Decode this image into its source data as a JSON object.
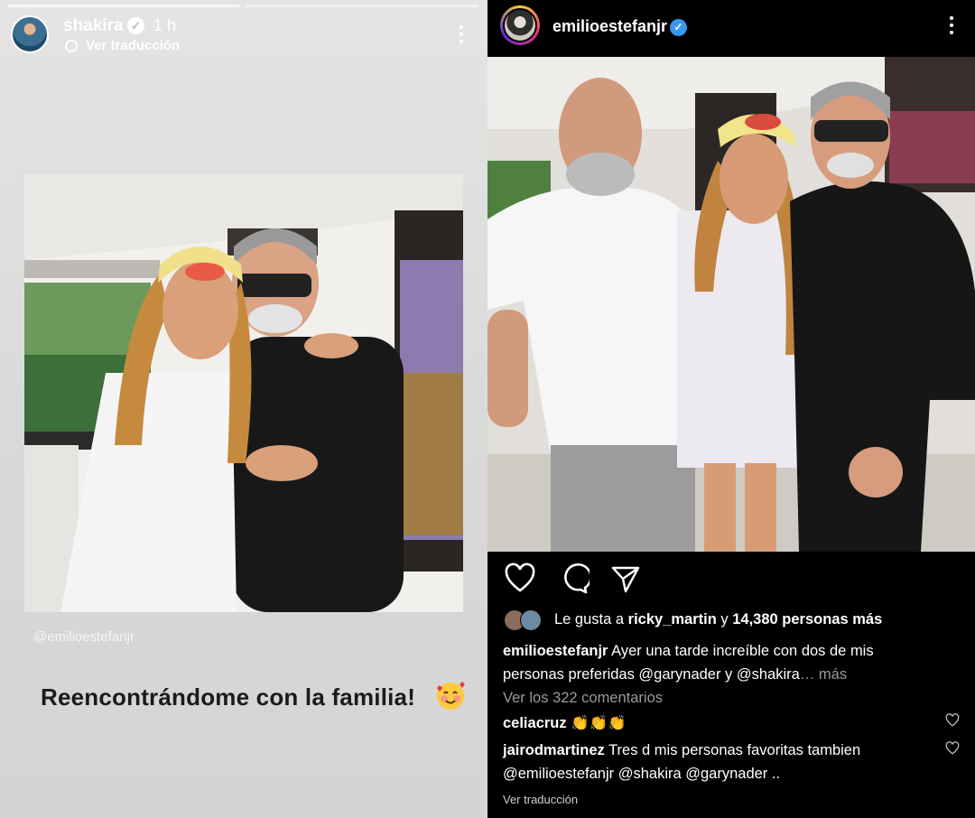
{
  "story": {
    "username": "shakira",
    "time": "1 h",
    "translate": "Ver traducción",
    "mention": "@emilioestefanjr",
    "caption": "Reencontrándome con la familia!"
  },
  "post": {
    "username": "emilioestefanjr",
    "liked_by_prefix": "Le gusta a",
    "liked_by_user": "ricky_martin",
    "liked_by_conj": "y",
    "liked_by_count": "14,380 personas más",
    "caption_user": "emilioestefanjr",
    "caption_text": "Ayer una tarde increíble con dos de mis personas preferidas @garynader y @shakira",
    "caption_more": "… más",
    "view_comments": "Ver los 322 comentarios",
    "comments": [
      {
        "user": "celiacruz",
        "text": "👏👏👏"
      },
      {
        "user": "jairodmartinez",
        "text": "Tres d mis personas favoritas tambien @emilioestefanjr @shakira @garynader .."
      }
    ],
    "see_translation": "Ver traducción"
  },
  "colors": {
    "verified_blue": "#3897f0",
    "story_bg": "#dedede",
    "post_bg": "#000000"
  }
}
